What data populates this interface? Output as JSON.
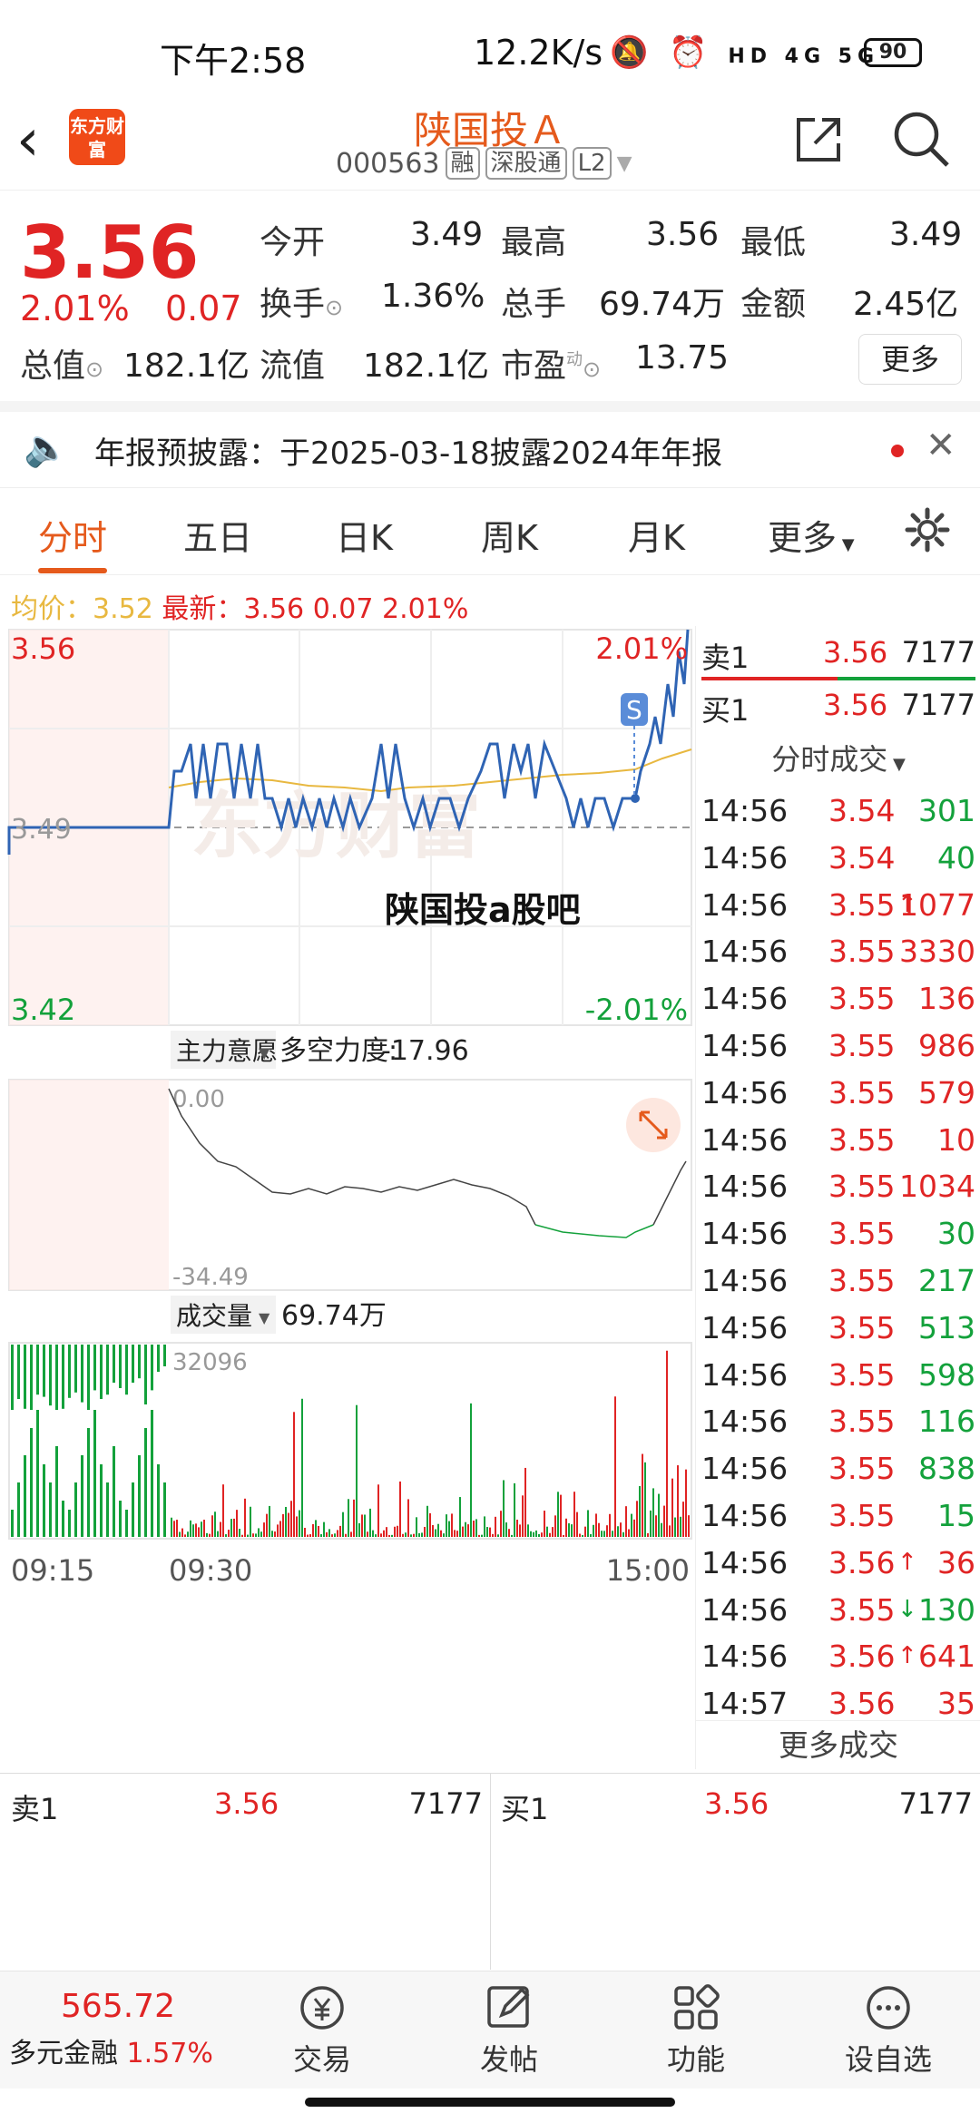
{
  "status_bar": {
    "time": "下午2:58",
    "net_speed": "12.2K/s",
    "signal": "HD 4G 5G",
    "battery": "90"
  },
  "header": {
    "logo": "东方财富",
    "name": "陕国投Ａ",
    "code": "000563",
    "tags": [
      "融",
      "深股通",
      "L2"
    ]
  },
  "quote": {
    "price": "3.56",
    "pct": "2.01%",
    "change": "0.07",
    "open_label": "今开",
    "open": "3.49",
    "high_label": "最高",
    "high": "3.56",
    "low_label": "最低",
    "low": "3.49",
    "turnover_label": "换手",
    "turnover": "1.36%",
    "volume_label": "总手",
    "volume": "69.74万",
    "amount_label": "金额",
    "amount": "2.45亿",
    "mcap_label": "总值",
    "mcap": "182.1亿",
    "float_label": "流值",
    "float": "182.1亿",
    "pe_label": "市盈",
    "pe_sup": "动",
    "pe": "13.75",
    "more": "更多"
  },
  "notice": {
    "text": "年报预披露：于2025-03-18披露2024年年报"
  },
  "tabs": [
    "分时",
    "五日",
    "日K",
    "周K",
    "月K",
    "更多"
  ],
  "avg_row": {
    "avg_label": "均价：",
    "avg": "3.52",
    "latest_label": "最新：",
    "latest": "3.56",
    "chg": "0.07",
    "pct": "2.01%"
  },
  "chart": {
    "top_price": "3.56",
    "top_pct": "2.01%",
    "mid_price": "3.49",
    "bottom_price": "3.42",
    "bottom_pct": "-2.01%",
    "watermark": "东方财富",
    "overlay_text": "陕国投a股吧",
    "marker": "S",
    "indicator_name": "主力意愿",
    "indicator_label": "多空力度:",
    "indicator_value": "-17.96",
    "ind_top": "0.00",
    "ind_bottom": "-34.49",
    "vol_name": "成交量",
    "vol_value": "69.74万",
    "vol_max": "32096",
    "x_labels": [
      "09:15",
      "09:30",
      "15:00"
    ]
  },
  "chart_data": {
    "type": "line",
    "ylim": [
      3.42,
      3.56
    ],
    "series": [],
    "x": [
      "09:15",
      "09:30",
      "15:00"
    ]
  },
  "orderbook": {
    "sell": {
      "label": "卖1",
      "price": "3.56",
      "qty": "7177"
    },
    "buy": {
      "label": "买1",
      "price": "3.56",
      "qty": "7177"
    }
  },
  "ticks_title": "分时成交",
  "ticks": [
    {
      "t": "14:56",
      "p": "3.54",
      "v": "301",
      "d": "",
      "c": "green"
    },
    {
      "t": "14:56",
      "p": "3.54",
      "v": "40",
      "d": "",
      "c": "green"
    },
    {
      "t": "14:56",
      "p": "3.55",
      "v": "1077",
      "d": "↑",
      "c": "red"
    },
    {
      "t": "14:56",
      "p": "3.55",
      "v": "3330",
      "d": "",
      "c": "red"
    },
    {
      "t": "14:56",
      "p": "3.55",
      "v": "136",
      "d": "",
      "c": "red"
    },
    {
      "t": "14:56",
      "p": "3.55",
      "v": "986",
      "d": "",
      "c": "red"
    },
    {
      "t": "14:56",
      "p": "3.55",
      "v": "579",
      "d": "",
      "c": "red"
    },
    {
      "t": "14:56",
      "p": "3.55",
      "v": "10",
      "d": "",
      "c": "red"
    },
    {
      "t": "14:56",
      "p": "3.55",
      "v": "1034",
      "d": "",
      "c": "red"
    },
    {
      "t": "14:56",
      "p": "3.55",
      "v": "30",
      "d": "",
      "c": "green"
    },
    {
      "t": "14:56",
      "p": "3.55",
      "v": "217",
      "d": "",
      "c": "green"
    },
    {
      "t": "14:56",
      "p": "3.55",
      "v": "513",
      "d": "",
      "c": "green"
    },
    {
      "t": "14:56",
      "p": "3.55",
      "v": "598",
      "d": "",
      "c": "green"
    },
    {
      "t": "14:56",
      "p": "3.55",
      "v": "116",
      "d": "",
      "c": "green"
    },
    {
      "t": "14:56",
      "p": "3.55",
      "v": "838",
      "d": "",
      "c": "green"
    },
    {
      "t": "14:56",
      "p": "3.55",
      "v": "15",
      "d": "",
      "c": "green"
    },
    {
      "t": "14:56",
      "p": "3.56",
      "v": "36",
      "d": "↑",
      "c": "red"
    },
    {
      "t": "14:56",
      "p": "3.55",
      "v": "130",
      "d": "↓",
      "c": "green"
    },
    {
      "t": "14:56",
      "p": "3.56",
      "v": "641",
      "d": "↑",
      "c": "red"
    },
    {
      "t": "14:57",
      "p": "3.56",
      "v": "35",
      "d": "",
      "c": "red"
    }
  ],
  "more_trades": "更多成交",
  "bottom_quote": {
    "sell_label": "卖1",
    "sell_price": "3.56",
    "sell_qty": "7177",
    "buy_label": "买1",
    "buy_price": "3.56",
    "buy_qty": "7177"
  },
  "nav": {
    "index_value": "565.72",
    "index_name": "多元金融",
    "index_pct": "1.57%",
    "items": [
      "交易",
      "发帖",
      "功能",
      "设自选"
    ]
  },
  "colors": {
    "up": "#e02424",
    "down": "#13a13b",
    "accent": "#e55a1c",
    "avg": "#e8b840",
    "price_line": "#2f64b4"
  }
}
